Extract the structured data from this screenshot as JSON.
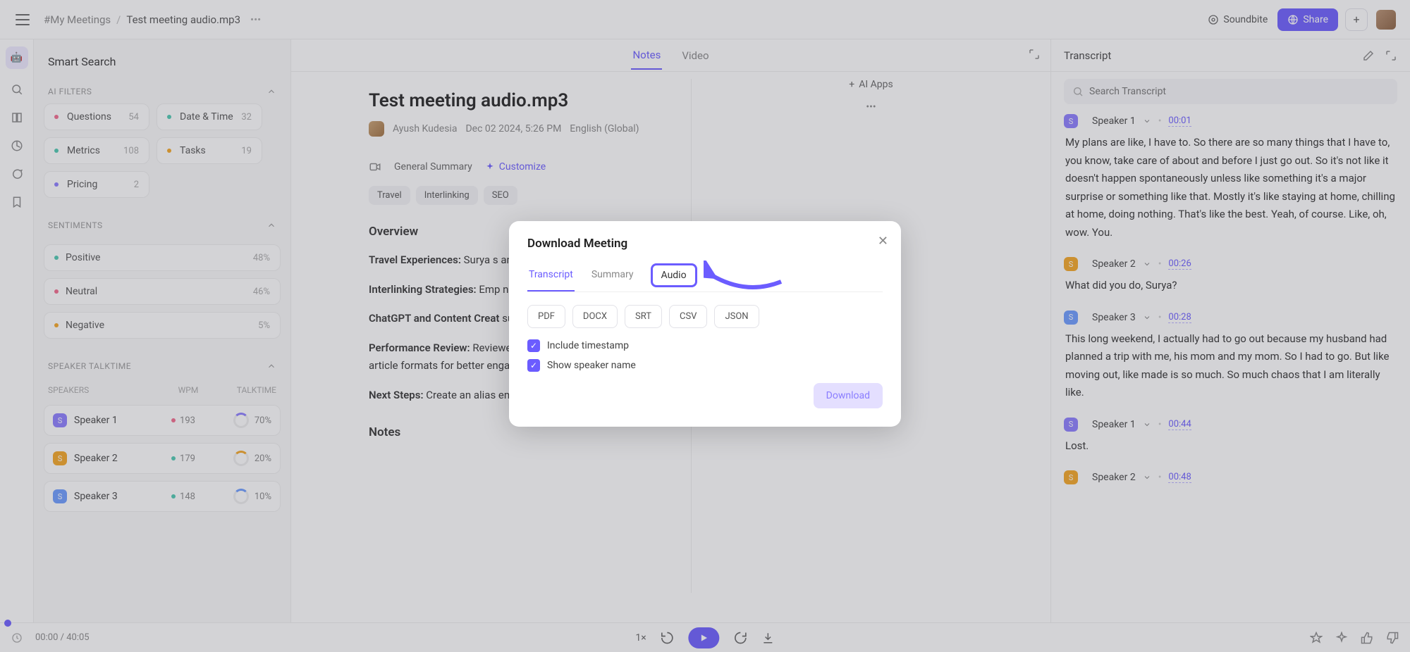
{
  "breadcrumb": {
    "root": "#My Meetings",
    "current": "Test meeting audio.mp3"
  },
  "topbar": {
    "soundbite": "Soundbite",
    "share": "Share"
  },
  "leftPanel": {
    "smartSearch": "Smart Search",
    "aiFilters": {
      "title": "AI FILTERS",
      "items": [
        {
          "label": "Questions",
          "count": "54",
          "color": "#f26a8d"
        },
        {
          "label": "Date & Time",
          "count": "32",
          "color": "#4cc9b0"
        },
        {
          "label": "Metrics",
          "count": "108",
          "color": "#4cc9b0"
        },
        {
          "label": "Tasks",
          "count": "19",
          "color": "#f5a623"
        },
        {
          "label": "Pricing",
          "count": "2",
          "color": "#8b7dff"
        }
      ]
    },
    "sentiments": {
      "title": "SENTIMENTS",
      "items": [
        {
          "label": "Positive",
          "pct": "48%",
          "color": "#4cc9b0"
        },
        {
          "label": "Neutral",
          "pct": "46%",
          "color": "#f26a8d"
        },
        {
          "label": "Negative",
          "pct": "5%",
          "color": "#f5a623"
        }
      ]
    },
    "talktime": {
      "title": "SPEAKER TALKTIME",
      "cols": {
        "speakers": "SPEAKERS",
        "wpm": "WPM",
        "talktime": "TALKTIME"
      },
      "rows": [
        {
          "name": "Speaker 1",
          "wpm": "193",
          "pct": "70%",
          "badge": "#8b7dff",
          "dot": "#f26a8d"
        },
        {
          "name": "Speaker 2",
          "wpm": "179",
          "pct": "20%",
          "badge": "#f5a623",
          "dot": "#4cc9b0"
        },
        {
          "name": "Speaker 3",
          "wpm": "148",
          "pct": "10%",
          "badge": "#6b9bff",
          "dot": "#4cc9b0"
        }
      ]
    }
  },
  "center": {
    "tabs": {
      "notes": "Notes",
      "video": "Video"
    },
    "title": "Test meeting audio.mp3",
    "author": "Ayush Kudesia",
    "datetime": "Dec 02 2024, 5:26 PM",
    "language": "English (Global)",
    "toolbar": {
      "summary": "General Summary",
      "customize": "Customize",
      "aiapps": "AI Apps"
    },
    "chips": [
      "Travel",
      "Interlinking",
      "SEO"
    ],
    "overviewTitle": "Overview",
    "overview": [
      {
        "label": "Travel Experiences:",
        "text": " Surya s                                                                                            and Singapore, exciting participants."
      },
      {
        "label": "Interlinking Strategies:",
        "text": " Emp                                                                                                 ng examples and tips for using slugs and "
      },
      {
        "label": "ChatGPT and Content Creat",
        "text": "                                                                                                  suggested using it for brainstorming rat                                           g"
      },
      {
        "label": "Performance Review:",
        "text": " Reviewed article performance metrics, discussing workload management and plans to experiment with article formats for better engagement."
      },
      {
        "label": "Next Steps:",
        "text": " Create an alias email for ChatGPT requests, share interlinking tips, and review article length impact on traffic."
      }
    ],
    "notesTitle": "Notes"
  },
  "transcript": {
    "title": "Transcript",
    "searchPlaceholder": "Search Transcript",
    "segments": [
      {
        "speaker": "Speaker 1",
        "badge": "#8b7dff",
        "ts": "00:01",
        "text": "My plans are like, I have to. So there are so many things that I have to, you know, take care of about and before I just go out. So it's not like it doesn't happen spontaneously unless like something it's a major surprise or something like that. Mostly it's like staying at home, chilling at home, doing nothing. That's like the best. Yeah, of course. Like, oh, wow. You."
      },
      {
        "speaker": "Speaker 2",
        "badge": "#f5a623",
        "ts": "00:26",
        "text": "What did you do, Surya?"
      },
      {
        "speaker": "Speaker 3",
        "badge": "#6b9bff",
        "ts": "00:28",
        "text": "This long weekend, I actually had to go out because my husband had planned a trip with me, his mom and my mom. So I had to go. But like moving out, like made is so much. So much chaos that I am literally like."
      },
      {
        "speaker": "Speaker 1",
        "badge": "#8b7dff",
        "ts": "00:44",
        "text": "Lost."
      },
      {
        "speaker": "Speaker 2",
        "badge": "#f5a623",
        "ts": "00:48",
        "text": ""
      }
    ]
  },
  "player": {
    "current": "00:00",
    "total": "40:05",
    "speed": "1×"
  },
  "modal": {
    "title": "Download Meeting",
    "tabs": {
      "transcript": "Transcript",
      "summary": "Summary",
      "audio": "Audio"
    },
    "formats": [
      "PDF",
      "DOCX",
      "SRT",
      "CSV",
      "JSON"
    ],
    "opt1": "Include timestamp",
    "opt2": "Show speaker name",
    "download": "Download"
  }
}
